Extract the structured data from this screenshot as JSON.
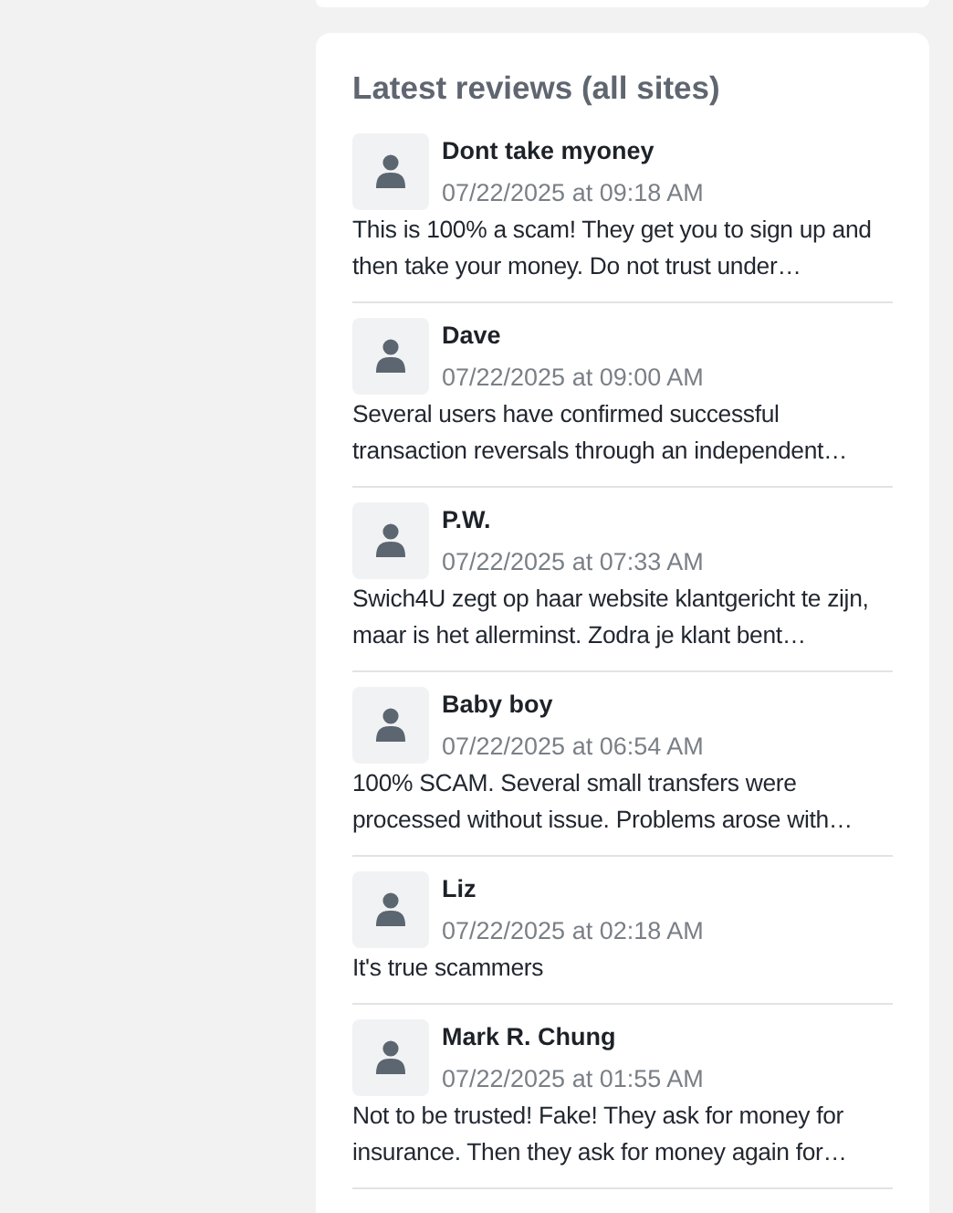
{
  "title": "Latest reviews (all sites)",
  "reviews": [
    {
      "name": "Dont take myoney",
      "date": "07/22/2025 at 09:18 AM",
      "text": "This is 100% a scam! They get you to sign up and then take your money. Do not trust under…"
    },
    {
      "name": "Dave",
      "date": "07/22/2025 at 09:00 AM",
      "text": "Several users have confirmed successful transaction reversals through an independent…"
    },
    {
      "name": "P.W.",
      "date": "07/22/2025 at 07:33 AM",
      "text": "Swich4U zegt op haar website klantgericht te zijn, maar is het allerminst. Zodra je klant bent…"
    },
    {
      "name": "Baby boy",
      "date": "07/22/2025 at 06:54 AM",
      "text": "100% SCAM. Several small transfers were processed without issue. Problems arose with…"
    },
    {
      "name": "Liz",
      "date": "07/22/2025 at 02:18 AM",
      "text": "It's true scammers"
    },
    {
      "name": "Mark R. Chung",
      "date": "07/22/2025 at 01:55 AM",
      "text": "Not to be trusted! Fake! They ask for money for insurance. Then they ask for money again for…"
    }
  ]
}
